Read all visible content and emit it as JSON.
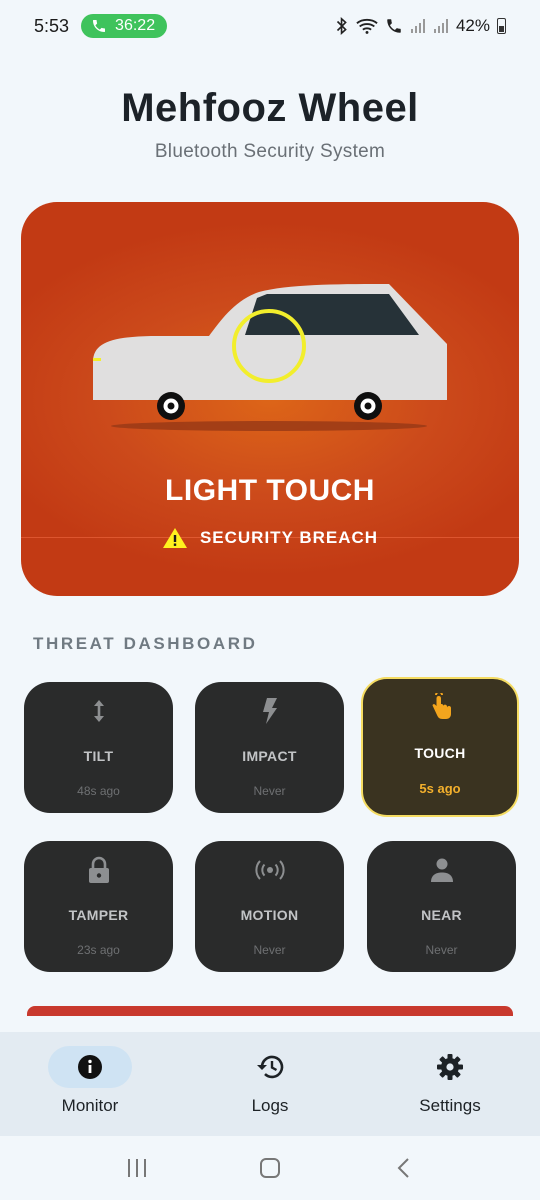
{
  "status_bar": {
    "time": "5:53",
    "call_duration": "36:22",
    "battery": "42%"
  },
  "header": {
    "title": "Mehfooz Wheel",
    "subtitle": "Bluetooth Security System"
  },
  "alert": {
    "title": "LIGHT TOUCH",
    "subtitle": "SECURITY BREACH",
    "colors": {
      "card": "#c94418",
      "highlight_ring": "#f2ee2c"
    }
  },
  "dashboard": {
    "title": "THREAT DASHBOARD",
    "tiles": [
      {
        "label": "TILT",
        "time": "48s ago",
        "icon": "vertical-arrows-icon",
        "active": false
      },
      {
        "label": "IMPACT",
        "time": "Never",
        "icon": "lightning-icon",
        "active": false
      },
      {
        "label": "TOUCH",
        "time": "5s ago",
        "icon": "touch-hand-icon",
        "active": true
      },
      {
        "label": "TAMPER",
        "time": "23s ago",
        "icon": "lock-icon",
        "active": false
      },
      {
        "label": "MOTION",
        "time": "Never",
        "icon": "broadcast-icon",
        "active": false
      },
      {
        "label": "NEAR",
        "time": "Never",
        "icon": "person-icon",
        "active": false
      }
    ]
  },
  "bottom_nav": {
    "items": [
      {
        "label": "Monitor",
        "icon": "info-icon",
        "selected": true
      },
      {
        "label": "Logs",
        "icon": "history-icon",
        "selected": false
      },
      {
        "label": "Settings",
        "icon": "gear-icon",
        "selected": false
      }
    ]
  }
}
